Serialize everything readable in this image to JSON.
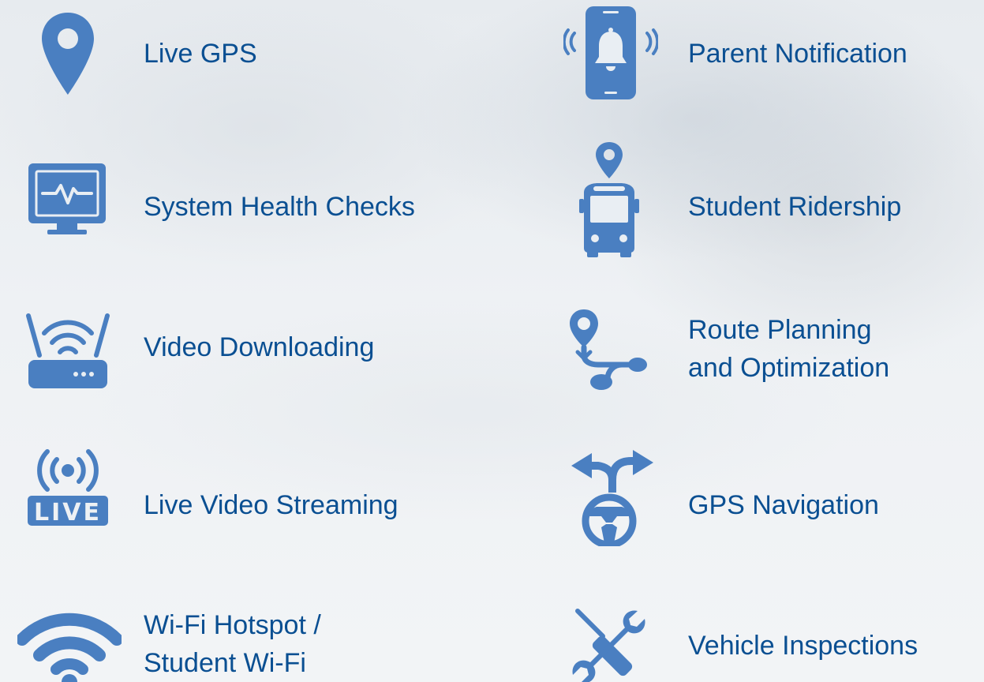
{
  "accent_color": "#4a7fc1",
  "text_color": "#0a4f92",
  "features": {
    "left": [
      {
        "icon": "map-pin-icon",
        "lines": [
          "Live GPS"
        ]
      },
      {
        "icon": "monitor-heartbeat-icon",
        "lines": [
          "System Health Checks"
        ]
      },
      {
        "icon": "wifi-router-icon",
        "lines": [
          "Video Downloading"
        ]
      },
      {
        "icon": "live-broadcast-icon",
        "lines": [
          "Live Video Streaming"
        ]
      },
      {
        "icon": "wifi-icon",
        "lines": [
          "Wi-Fi Hotspot /",
          "Student Wi-Fi"
        ]
      }
    ],
    "right": [
      {
        "icon": "phone-bell-icon",
        "lines": [
          "Parent Notification"
        ]
      },
      {
        "icon": "bus-pin-icon",
        "lines": [
          "Student Ridership"
        ]
      },
      {
        "icon": "route-icon",
        "lines": [
          "Route Planning",
          "and Optimization"
        ]
      },
      {
        "icon": "steering-wheel-arrows-icon",
        "lines": [
          "GPS Navigation"
        ]
      },
      {
        "icon": "tools-icon",
        "lines": [
          "Vehicle Inspections"
        ]
      }
    ]
  }
}
